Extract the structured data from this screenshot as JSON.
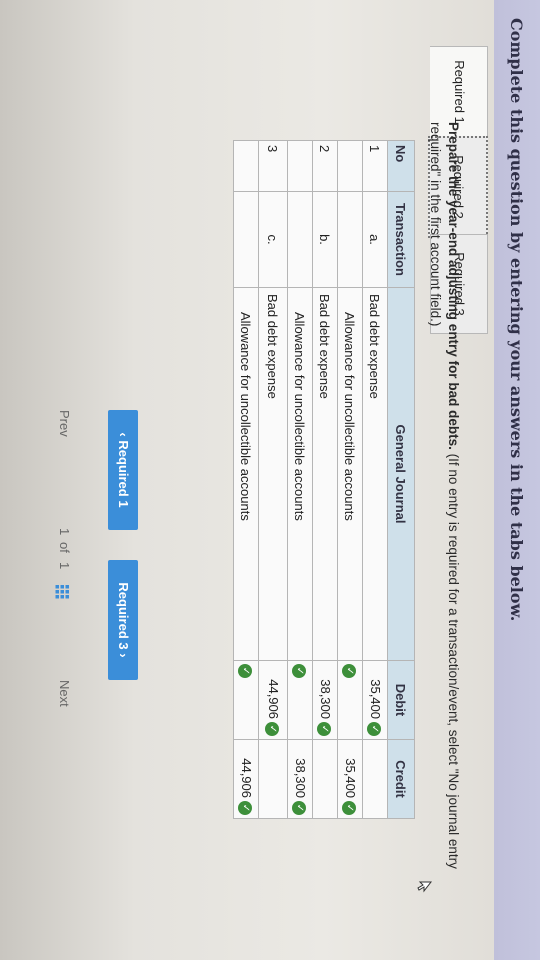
{
  "banner": {
    "text": "Complete this question by entering your answers in the tabs below."
  },
  "tabs": [
    {
      "label": "Required 1"
    },
    {
      "label": "Required 2"
    },
    {
      "label": "Required 3"
    }
  ],
  "instructions": {
    "main": "Prepare the year-end adjusting entry for bad debts.",
    "note": "(If no entry is required for a transaction/event, select \"No journal entry required\" in the first account field.)"
  },
  "table": {
    "headers": {
      "no": "No",
      "transaction": "Transaction",
      "journal": "General Journal",
      "debit": "Debit",
      "credit": "Credit"
    },
    "rows": [
      {
        "no": "1",
        "transaction": "a.",
        "account": "Bad debt expense",
        "debit": "35,400",
        "credit": ""
      },
      {
        "no": "",
        "transaction": "",
        "account": "Allowance for uncollectible accounts",
        "debit": "",
        "credit": "35,400"
      },
      {
        "no": "2",
        "transaction": "b.",
        "account": "Bad debt expense",
        "debit": "38,300",
        "credit": ""
      },
      {
        "no": "",
        "transaction": "",
        "account": "Allowance for uncollectible accounts",
        "debit": "",
        "credit": "38,300"
      },
      {
        "no": "3",
        "transaction": "c.",
        "account": "Bad debt expense",
        "debit": "44,906",
        "credit": ""
      },
      {
        "no": "",
        "transaction": "",
        "account": "Allowance for uncollectible accounts",
        "debit": "",
        "credit": "44,906"
      }
    ]
  },
  "nav": {
    "prev_label": "Required 1",
    "next_label": "Required 3"
  },
  "pager": {
    "prev": "Prev",
    "page": "1",
    "of": "of",
    "total": "1",
    "next": "Next"
  },
  "icons": {
    "check": "check-icon",
    "grid": "grid-icon",
    "cursor": "cursor-icon"
  },
  "colors": {
    "accent": "#3b8ed9",
    "check": "#3d8f3a",
    "banner": "#c4c4de"
  }
}
